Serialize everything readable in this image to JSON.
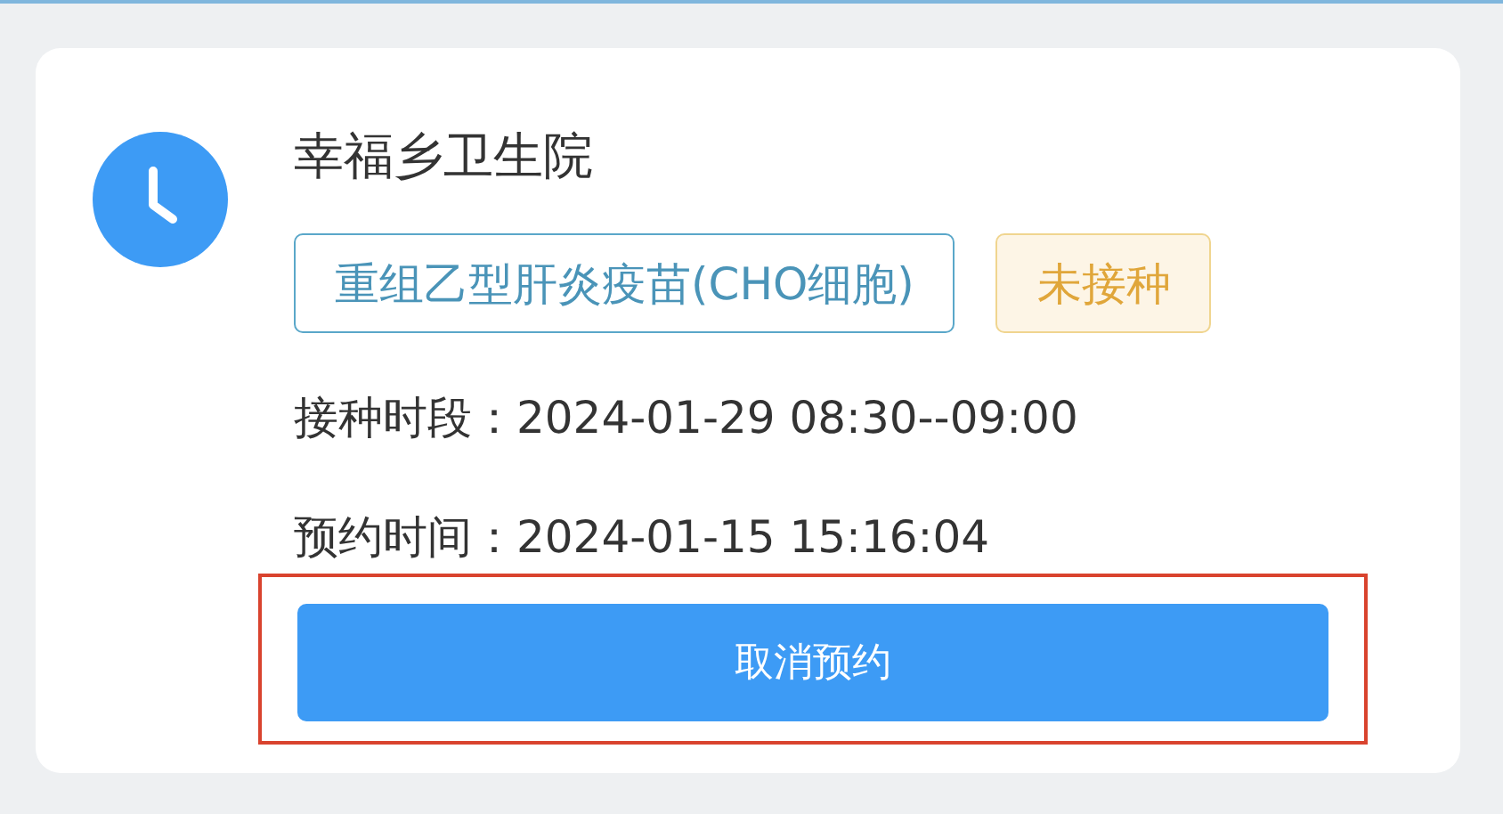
{
  "card": {
    "title": "幸福乡卫生院",
    "tags": [
      {
        "kind": "vaccine",
        "label": "重组乙型肝炎疫苗(CHO细胞)"
      },
      {
        "kind": "status",
        "label": "未接种"
      }
    ],
    "details": [
      {
        "label": "接种时段：",
        "value": "2024-01-29 08:30--09:00"
      },
      {
        "label": "预约时间：",
        "value": "2024-01-15 15:16:04"
      }
    ],
    "button": {
      "label": "取消预约",
      "highlighted": true
    }
  }
}
